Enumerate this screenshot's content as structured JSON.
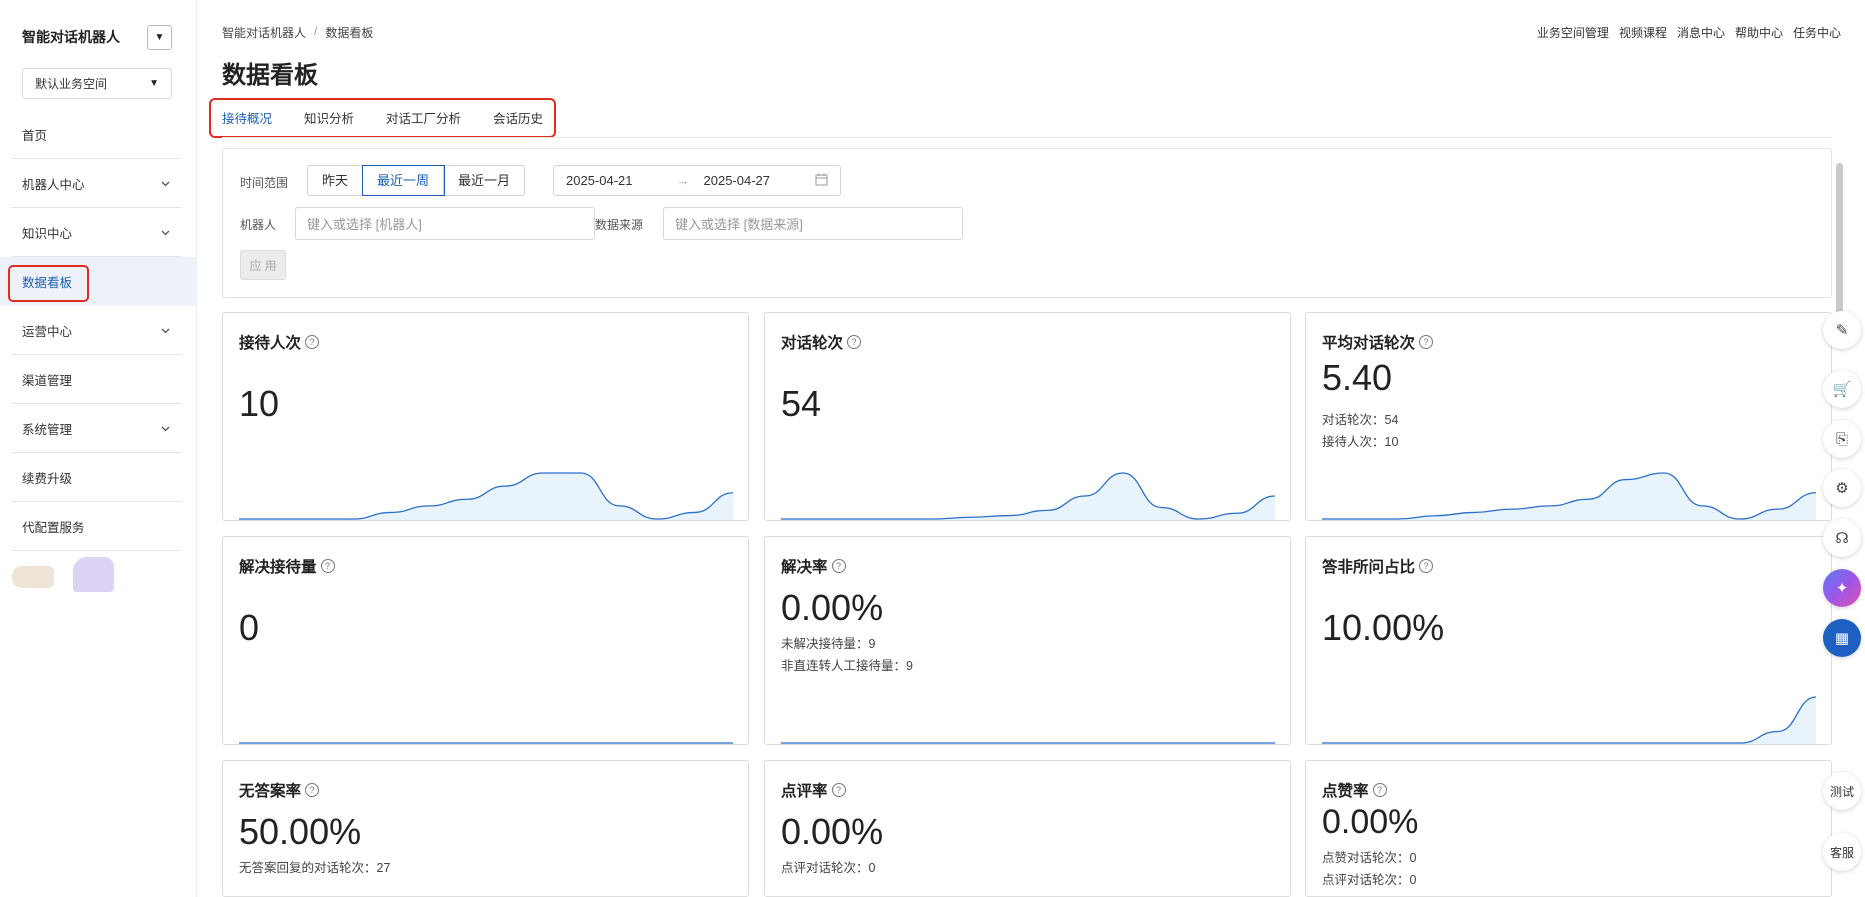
{
  "sidebar": {
    "app_title": "智能对话机器人",
    "toggle_icon": "caret-down-icon",
    "workspace": "默认业务空间",
    "items": [
      {
        "label": "首页",
        "has_chevron": false
      },
      {
        "label": "机器人中心",
        "has_chevron": true
      },
      {
        "label": "知识中心",
        "has_chevron": true
      },
      {
        "label": "数据看板",
        "has_chevron": false,
        "active": true
      },
      {
        "label": "运营中心",
        "has_chevron": true
      },
      {
        "label": "渠道管理",
        "has_chevron": false
      },
      {
        "label": "系统管理",
        "has_chevron": true
      },
      {
        "label": "续费升级",
        "has_chevron": false
      },
      {
        "label": "代配置服务",
        "has_chevron": false
      }
    ]
  },
  "breadcrumb": {
    "root": "智能对话机器人",
    "sep": "/",
    "current": "数据看板"
  },
  "top_links": [
    "业务空间管理",
    "视频课程",
    "消息中心",
    "帮助中心",
    "任务中心"
  ],
  "page_title": "数据看板",
  "tabs": [
    "接待概况",
    "知识分析",
    "对话工厂分析",
    "会话历史"
  ],
  "filter": {
    "time_label": "时间范围",
    "time_options": [
      "昨天",
      "最近一周",
      "最近一月"
    ],
    "time_selected": "最近一周",
    "date_start": "2025-04-21",
    "date_arrow": "→",
    "date_end": "2025-04-27",
    "robot_label": "机器人",
    "robot_placeholder": "键入或选择 [机器人]",
    "source_label": "数据来源",
    "source_placeholder": "键入或选择 [数据来源]",
    "apply": "应 用"
  },
  "cards": [
    {
      "title": "接待人次",
      "value": "10",
      "subs": [],
      "trend": [
        0,
        0,
        0,
        0,
        1,
        2,
        3,
        5,
        7,
        7,
        2,
        0,
        1,
        4
      ]
    },
    {
      "title": "对话轮次",
      "value": "54",
      "subs": [],
      "trend": [
        0,
        0,
        0,
        0,
        0,
        0.3,
        0.6,
        1.5,
        4,
        8,
        2,
        0,
        1,
        4
      ]
    },
    {
      "title": "平均对话轮次",
      "value": "5.40",
      "subs": [
        "对话轮次：54",
        "接待人次：10"
      ],
      "trend": [
        0,
        0,
        0,
        0.5,
        1,
        1.5,
        2,
        3,
        6,
        7,
        2,
        0,
        1.5,
        4
      ]
    },
    {
      "title": "解决接待量",
      "value": "0",
      "subs": [],
      "trend": [
        0,
        0,
        0,
        0,
        0,
        0,
        0,
        0,
        0,
        0,
        0,
        0,
        0,
        0
      ]
    },
    {
      "title": "解决率",
      "value": "0.00%",
      "subs": [
        "未解决接待量：9",
        "非直连转人工接待量：9"
      ],
      "trend": [
        0,
        0,
        0,
        0,
        0,
        0,
        0,
        0,
        0,
        0,
        0,
        0,
        0,
        0
      ]
    },
    {
      "title": "答非所问占比",
      "value": "10.00%",
      "subs": [],
      "trend": [
        0,
        0,
        0,
        0,
        0,
        0,
        0,
        0,
        0,
        0,
        0,
        0,
        1,
        4
      ]
    },
    {
      "title": "无答案率",
      "value": "50.00%",
      "subs": [
        "无答案回复的对话轮次：27"
      ],
      "trend": []
    },
    {
      "title": "点评率",
      "value": "0.00%",
      "subs": [
        "点评对话轮次：0"
      ],
      "trend": []
    },
    {
      "title": "点赞率",
      "value": "0.00%",
      "subs": [
        "点赞对话轮次：0",
        "点评对话轮次：0"
      ],
      "trend": []
    }
  ],
  "float_buttons": [
    {
      "name": "edit-icon",
      "glyph": "✎"
    },
    {
      "name": "cart-icon",
      "glyph": "🛒"
    },
    {
      "name": "api-icon",
      "glyph": "⎘"
    },
    {
      "name": "settings-icon",
      "glyph": "⚙"
    },
    {
      "name": "headset-icon",
      "glyph": "☊"
    },
    {
      "name": "ai-assistant-icon",
      "glyph": "✦"
    },
    {
      "name": "apps-icon",
      "glyph": "▦"
    }
  ],
  "float_text_buttons": [
    "测试",
    "客服"
  ],
  "colors": {
    "accent": "#1a5fb4",
    "highlight_outline": "#e02b1f",
    "chart_line": "#2a6fc9",
    "chart_fill": "#e8f3fc"
  }
}
